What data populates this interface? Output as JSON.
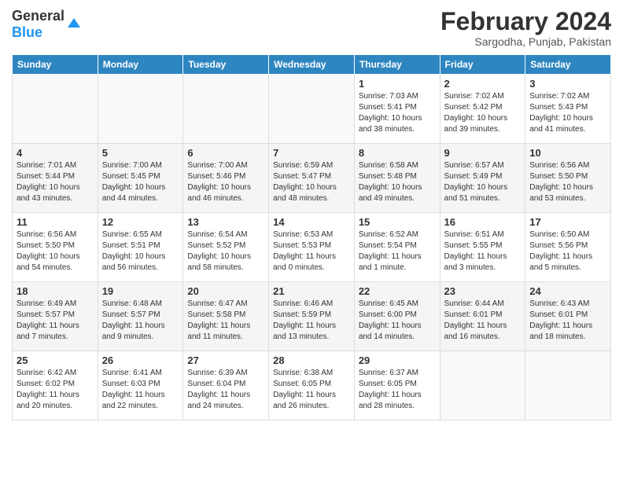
{
  "header": {
    "logo_general": "General",
    "logo_blue": "Blue",
    "month_title": "February 2024",
    "location": "Sargodha, Punjab, Pakistan"
  },
  "days_of_week": [
    "Sunday",
    "Monday",
    "Tuesday",
    "Wednesday",
    "Thursday",
    "Friday",
    "Saturday"
  ],
  "weeks": [
    [
      {
        "day": "",
        "info": ""
      },
      {
        "day": "",
        "info": ""
      },
      {
        "day": "",
        "info": ""
      },
      {
        "day": "",
        "info": ""
      },
      {
        "day": "1",
        "info": "Sunrise: 7:03 AM\nSunset: 5:41 PM\nDaylight: 10 hours\nand 38 minutes."
      },
      {
        "day": "2",
        "info": "Sunrise: 7:02 AM\nSunset: 5:42 PM\nDaylight: 10 hours\nand 39 minutes."
      },
      {
        "day": "3",
        "info": "Sunrise: 7:02 AM\nSunset: 5:43 PM\nDaylight: 10 hours\nand 41 minutes."
      }
    ],
    [
      {
        "day": "4",
        "info": "Sunrise: 7:01 AM\nSunset: 5:44 PM\nDaylight: 10 hours\nand 43 minutes."
      },
      {
        "day": "5",
        "info": "Sunrise: 7:00 AM\nSunset: 5:45 PM\nDaylight: 10 hours\nand 44 minutes."
      },
      {
        "day": "6",
        "info": "Sunrise: 7:00 AM\nSunset: 5:46 PM\nDaylight: 10 hours\nand 46 minutes."
      },
      {
        "day": "7",
        "info": "Sunrise: 6:59 AM\nSunset: 5:47 PM\nDaylight: 10 hours\nand 48 minutes."
      },
      {
        "day": "8",
        "info": "Sunrise: 6:58 AM\nSunset: 5:48 PM\nDaylight: 10 hours\nand 49 minutes."
      },
      {
        "day": "9",
        "info": "Sunrise: 6:57 AM\nSunset: 5:49 PM\nDaylight: 10 hours\nand 51 minutes."
      },
      {
        "day": "10",
        "info": "Sunrise: 6:56 AM\nSunset: 5:50 PM\nDaylight: 10 hours\nand 53 minutes."
      }
    ],
    [
      {
        "day": "11",
        "info": "Sunrise: 6:56 AM\nSunset: 5:50 PM\nDaylight: 10 hours\nand 54 minutes."
      },
      {
        "day": "12",
        "info": "Sunrise: 6:55 AM\nSunset: 5:51 PM\nDaylight: 10 hours\nand 56 minutes."
      },
      {
        "day": "13",
        "info": "Sunrise: 6:54 AM\nSunset: 5:52 PM\nDaylight: 10 hours\nand 58 minutes."
      },
      {
        "day": "14",
        "info": "Sunrise: 6:53 AM\nSunset: 5:53 PM\nDaylight: 11 hours\nand 0 minutes."
      },
      {
        "day": "15",
        "info": "Sunrise: 6:52 AM\nSunset: 5:54 PM\nDaylight: 11 hours\nand 1 minute."
      },
      {
        "day": "16",
        "info": "Sunrise: 6:51 AM\nSunset: 5:55 PM\nDaylight: 11 hours\nand 3 minutes."
      },
      {
        "day": "17",
        "info": "Sunrise: 6:50 AM\nSunset: 5:56 PM\nDaylight: 11 hours\nand 5 minutes."
      }
    ],
    [
      {
        "day": "18",
        "info": "Sunrise: 6:49 AM\nSunset: 5:57 PM\nDaylight: 11 hours\nand 7 minutes."
      },
      {
        "day": "19",
        "info": "Sunrise: 6:48 AM\nSunset: 5:57 PM\nDaylight: 11 hours\nand 9 minutes."
      },
      {
        "day": "20",
        "info": "Sunrise: 6:47 AM\nSunset: 5:58 PM\nDaylight: 11 hours\nand 11 minutes."
      },
      {
        "day": "21",
        "info": "Sunrise: 6:46 AM\nSunset: 5:59 PM\nDaylight: 11 hours\nand 13 minutes."
      },
      {
        "day": "22",
        "info": "Sunrise: 6:45 AM\nSunset: 6:00 PM\nDaylight: 11 hours\nand 14 minutes."
      },
      {
        "day": "23",
        "info": "Sunrise: 6:44 AM\nSunset: 6:01 PM\nDaylight: 11 hours\nand 16 minutes."
      },
      {
        "day": "24",
        "info": "Sunrise: 6:43 AM\nSunset: 6:01 PM\nDaylight: 11 hours\nand 18 minutes."
      }
    ],
    [
      {
        "day": "25",
        "info": "Sunrise: 6:42 AM\nSunset: 6:02 PM\nDaylight: 11 hours\nand 20 minutes."
      },
      {
        "day": "26",
        "info": "Sunrise: 6:41 AM\nSunset: 6:03 PM\nDaylight: 11 hours\nand 22 minutes."
      },
      {
        "day": "27",
        "info": "Sunrise: 6:39 AM\nSunset: 6:04 PM\nDaylight: 11 hours\nand 24 minutes."
      },
      {
        "day": "28",
        "info": "Sunrise: 6:38 AM\nSunset: 6:05 PM\nDaylight: 11 hours\nand 26 minutes."
      },
      {
        "day": "29",
        "info": "Sunrise: 6:37 AM\nSunset: 6:05 PM\nDaylight: 11 hours\nand 28 minutes."
      },
      {
        "day": "",
        "info": ""
      },
      {
        "day": "",
        "info": ""
      }
    ]
  ]
}
